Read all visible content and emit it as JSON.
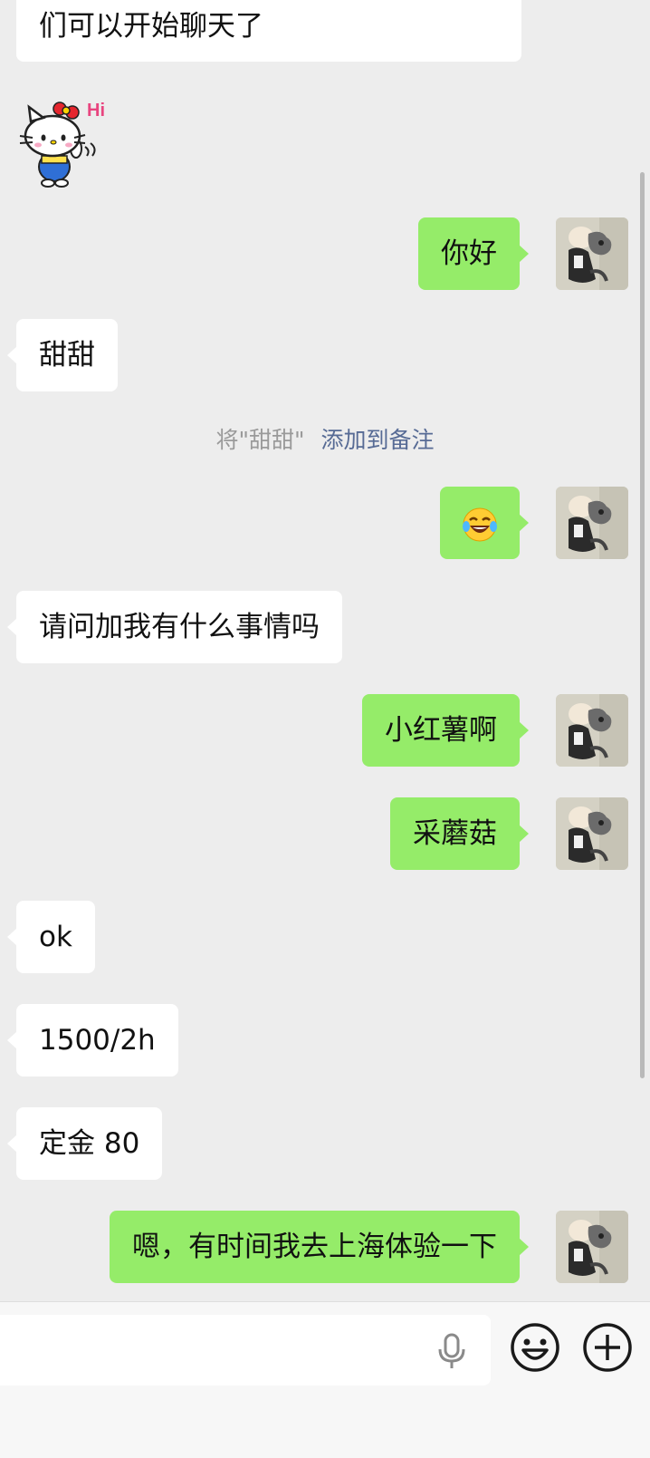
{
  "messages": {
    "m0": "们可以开始聊天了",
    "m1": "你好",
    "m2": "甜甜",
    "m4": "请问加我有什么事情吗",
    "m5": "小红薯啊",
    "m6": "采蘑菇",
    "m7": "ok",
    "m8": "1500/2h",
    "m9": "定金 80",
    "m10": "嗯，有时间我去上海体验一下"
  },
  "system_note": {
    "text": "将\"甜甜\"",
    "link": "添加到备注"
  },
  "sticker": {
    "name": "hello-kitty-hi-sticker",
    "label": "Hi"
  },
  "icons": {
    "emoji": "laughing-with-tears-emoji",
    "mic": "microphone-icon",
    "emoji_button": "smiley-icon",
    "plus": "plus-circle-icon"
  },
  "colors": {
    "background": "#ededed",
    "incoming_bubble": "#ffffff",
    "outgoing_bubble": "#95ec69",
    "link": "#576b95"
  }
}
